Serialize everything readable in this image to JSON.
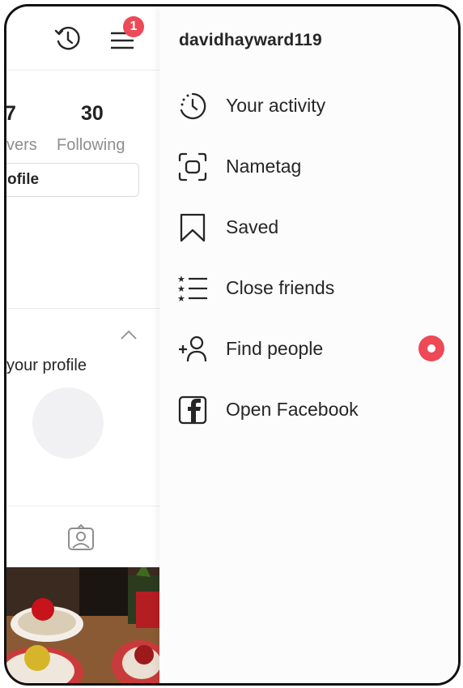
{
  "header": {
    "notification_count": "1",
    "username": "davidhayward119"
  },
  "profile": {
    "followers_number": "7",
    "followers_label": "vers",
    "following_number": "30",
    "following_label": "Following",
    "edit_profile_label": "ofile",
    "discover_text": "your profile"
  },
  "menu": {
    "items": [
      {
        "label": "Your activity",
        "icon": "activity-icon"
      },
      {
        "label": "Nametag",
        "icon": "nametag-icon"
      },
      {
        "label": "Saved",
        "icon": "bookmark-icon"
      },
      {
        "label": "Close friends",
        "icon": "close-friends-icon"
      },
      {
        "label": "Find people",
        "icon": "add-person-icon",
        "has_dot": true
      },
      {
        "label": "Open Facebook",
        "icon": "facebook-icon"
      }
    ]
  },
  "colors": {
    "badge_red": "#ed4956",
    "text_dark": "#262626",
    "text_muted": "#8e8e8e"
  }
}
